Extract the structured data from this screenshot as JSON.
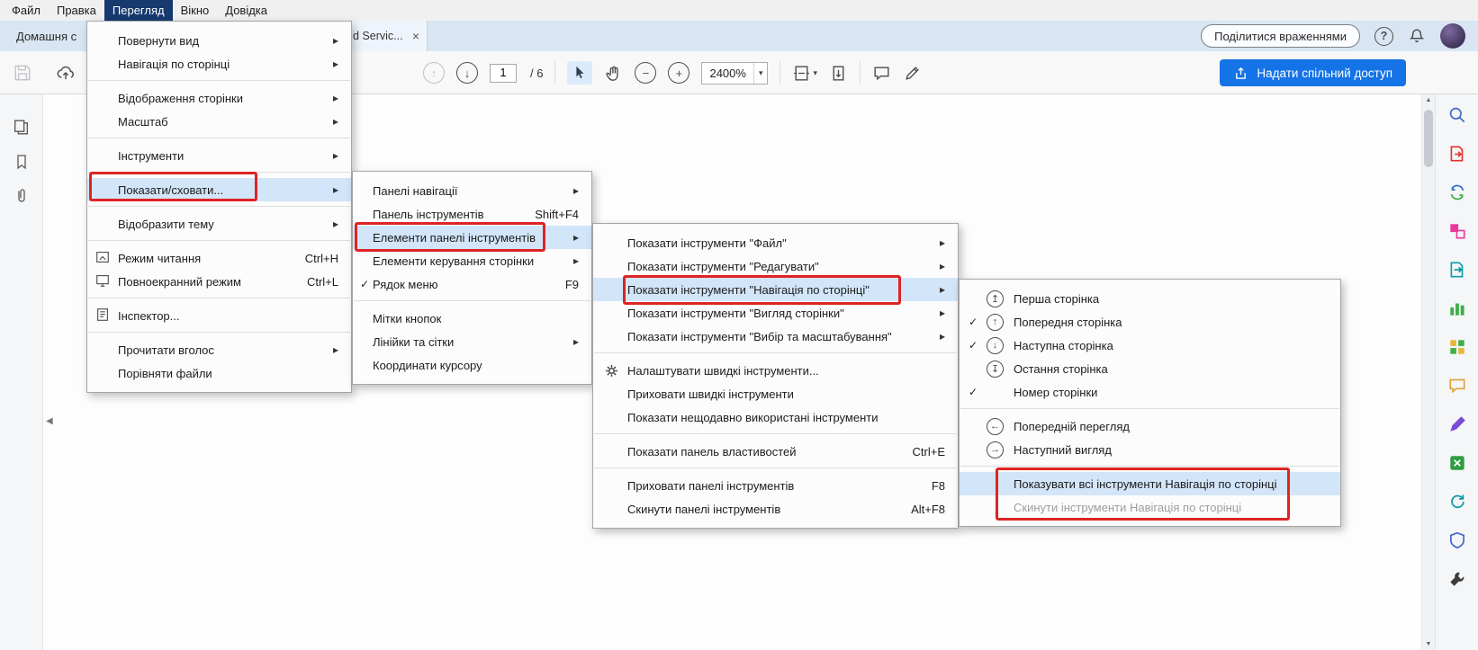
{
  "menubar": {
    "items": [
      {
        "label": "Файл"
      },
      {
        "label": "Правка"
      },
      {
        "label": "Перегляд"
      },
      {
        "label": "Вікно"
      },
      {
        "label": "Довідка"
      }
    ]
  },
  "tabbar": {
    "home_tab": "Домашня с",
    "doc_tab": "d Servic...",
    "share_feedback_button": "Поділитися враженнями"
  },
  "toolbar": {
    "page_current": "1",
    "page_total": "/ 6",
    "zoom_value": "2400%",
    "share_button": "Надати спільний доступ"
  },
  "menus": {
    "view": {
      "items": [
        {
          "label": "Повернути вид"
        },
        {
          "label": "Навігація по сторінці"
        },
        {
          "label": "Відображення сторінки"
        },
        {
          "label": "Масштаб"
        },
        {
          "label": "Інструменти"
        },
        {
          "label": "Показати/сховати..."
        },
        {
          "label": "Відобразити тему"
        },
        {
          "label": "Режим читання",
          "shortcut": "Ctrl+H"
        },
        {
          "label": "Повноекранний режим",
          "shortcut": "Ctrl+L"
        },
        {
          "label": "Інспектор..."
        },
        {
          "label": "Прочитати вголос"
        },
        {
          "label": "Порівняти файли"
        }
      ]
    },
    "show_hide": {
      "items": [
        {
          "label": "Панелі навігації"
        },
        {
          "label": "Панель інструментів",
          "shortcut": "Shift+F4"
        },
        {
          "label": "Елементи панелі інструментів"
        },
        {
          "label": "Елементи керування сторінки"
        },
        {
          "label": "Рядок меню",
          "shortcut": "F9"
        },
        {
          "label": "Мітки кнопок"
        },
        {
          "label": "Лінійки та сітки"
        },
        {
          "label": "Координати курсору"
        }
      ]
    },
    "toolbar_items": {
      "items": [
        {
          "label": "Показати інструменти \"Файл\""
        },
        {
          "label": "Показати інструменти \"Редагувати\""
        },
        {
          "label": "Показати інструменти \"Навігація по сторінці\""
        },
        {
          "label": "Показати інструменти \"Вигляд сторінки\""
        },
        {
          "label": "Показати інструменти \"Вибір та масштабування\""
        },
        {
          "label": "Налаштувати швидкі інструменти..."
        },
        {
          "label": "Приховати швидкі інструменти"
        },
        {
          "label": "Показати нещодавно використані інструменти"
        },
        {
          "label": "Показати панель властивостей",
          "shortcut": "Ctrl+E"
        },
        {
          "label": "Приховати панелі інструментів",
          "shortcut": "F8"
        },
        {
          "label": "Скинути панелі інструментів",
          "shortcut": "Alt+F8"
        }
      ]
    },
    "page_nav": {
      "items": [
        {
          "label": "Перша сторінка"
        },
        {
          "label": "Попередня сторінка"
        },
        {
          "label": "Наступна сторінка"
        },
        {
          "label": "Остання сторінка"
        },
        {
          "label": "Номер сторінки"
        },
        {
          "label": "Попередній перегляд"
        },
        {
          "label": "Наступний вигляд"
        },
        {
          "label": "Показувати всі інструменти Навігація по сторінці"
        },
        {
          "label": "Скинути інструменти Навігація по сторінці"
        }
      ]
    }
  },
  "icons": {
    "submenu_arrow": "▸",
    "checkmark": "✓",
    "close": "×",
    "caret_down": "▾",
    "zoom_out": "−",
    "zoom_in": "+",
    "first_page": "↥",
    "prev_page": "↑",
    "next_page": "↓",
    "last_page": "↧",
    "prev_view": "←",
    "next_view": "→",
    "scroll_up": "▲",
    "scroll_down": "▼",
    "collapse_left": "◀",
    "help": "?"
  },
  "colors": {
    "accent_blue": "#1473e6",
    "menu_highlight": "#d2e5f9",
    "annotation_red": "#de2424",
    "menubar_active": "#16396e"
  }
}
